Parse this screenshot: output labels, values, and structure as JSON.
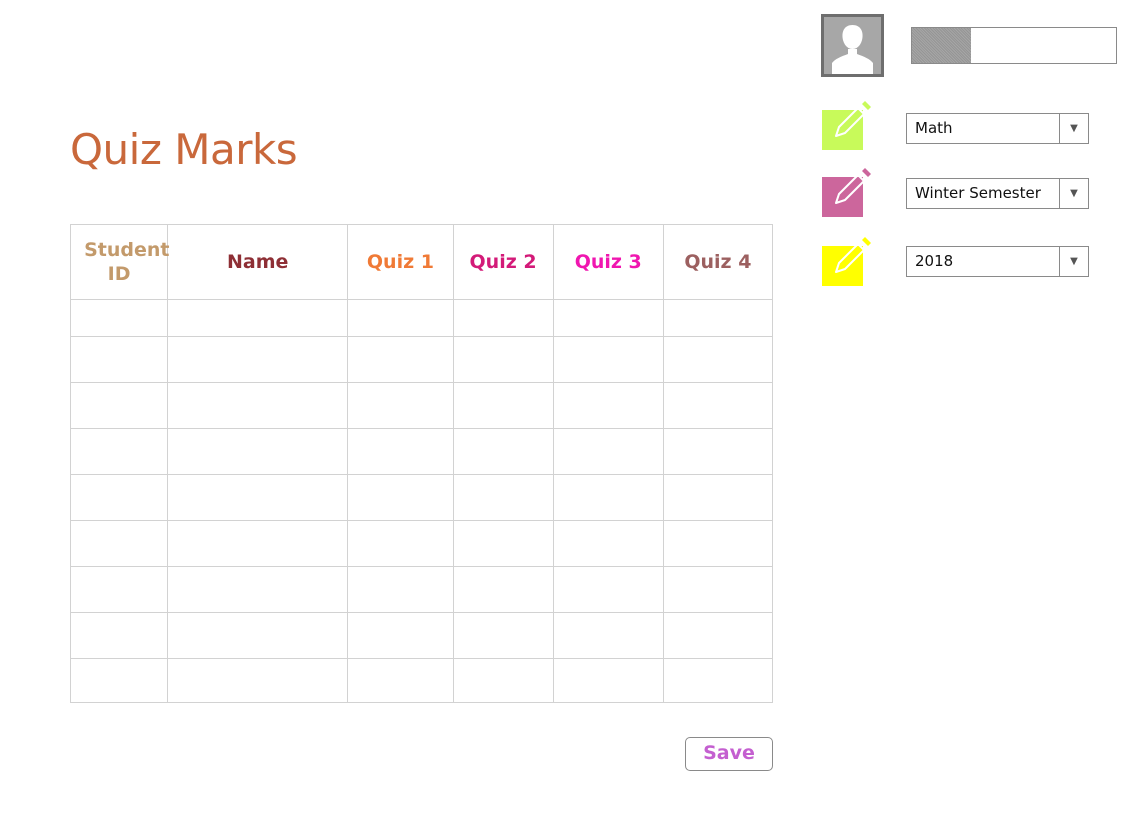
{
  "page": {
    "title": "Quiz Marks",
    "title_color": "#c9683b"
  },
  "table": {
    "headers": [
      {
        "label": "Student ID",
        "color": "#c39a6b"
      },
      {
        "label": "Name",
        "color": "#8e2f35"
      },
      {
        "label": "Quiz 1",
        "color": "#f07a36"
      },
      {
        "label": "Quiz 2",
        "color": "#d31a78"
      },
      {
        "label": "Quiz 3",
        "color": "#f016b0"
      },
      {
        "label": "Quiz 4",
        "color": "#9c6060"
      }
    ],
    "rows": [
      [
        "",
        "",
        "",
        "",
        "",
        ""
      ],
      [
        "",
        "",
        "",
        "",
        "",
        ""
      ],
      [
        "",
        "",
        "",
        "",
        "",
        ""
      ],
      [
        "",
        "",
        "",
        "",
        "",
        ""
      ],
      [
        "",
        "",
        "",
        "",
        "",
        ""
      ],
      [
        "",
        "",
        "",
        "",
        "",
        ""
      ],
      [
        "",
        "",
        "",
        "",
        "",
        ""
      ],
      [
        "",
        "",
        "",
        "",
        "",
        ""
      ],
      [
        "",
        "",
        "",
        "",
        "",
        ""
      ]
    ]
  },
  "save_button": {
    "label": "Save",
    "color": "#c45fd0"
  },
  "user": {
    "avatar_icon": "user-silhouette-icon",
    "progress": 0.29
  },
  "filters": [
    {
      "icon": "pencil-icon",
      "icon_color": "#c8fa5a",
      "selected": "Math"
    },
    {
      "icon": "pencil-icon",
      "icon_color": "#cc669c",
      "selected": "Winter Semester"
    },
    {
      "icon": "pencil-icon",
      "icon_color": "#ffff00",
      "selected": "2018"
    }
  ],
  "icons": {
    "dropdown": "chevron-down-icon",
    "dropdown_glyph": "▼"
  }
}
